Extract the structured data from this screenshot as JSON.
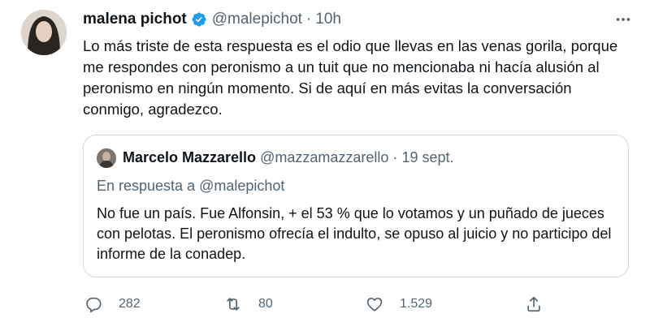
{
  "tweet": {
    "author_name": "malena pichot",
    "handle": "@malepichot",
    "separator": "·",
    "time": "10h",
    "text": "Lo más triste de esta respuesta es el odio que llevas en las venas gorila, porque me respondes con peronismo a un tuit que no mencionaba ni hacía alusión al peronismo en ningún momento. Si de aquí en más evitas la conversación conmigo, agradezco.",
    "verified": true,
    "avatar": "profile-photo",
    "more_icon": "more-horizontal-icon"
  },
  "quote": {
    "author_name": "Marcelo Mazzarello",
    "handle": "@mazzamazzarello",
    "separator": "·",
    "date": "19 sept.",
    "reply_line": "En respuesta a @malepichot",
    "text": "No fue un país. Fue Alfonsin, + el 53 % que lo votamos  y un puñado de jueces con pelotas. El peronismo ofrecía el indulto, se opuso al juicio  y no participo del informe de la conadep."
  },
  "actions": {
    "reply_count": "282",
    "retweet_count": "80",
    "like_count": "1.529",
    "icons": [
      "reply-icon",
      "retweet-icon",
      "like-icon",
      "share-icon"
    ]
  },
  "colors": {
    "verified": "#1d9bf0",
    "text": "#0f1419",
    "secondary": "#536471",
    "border": "#cfd9de"
  }
}
